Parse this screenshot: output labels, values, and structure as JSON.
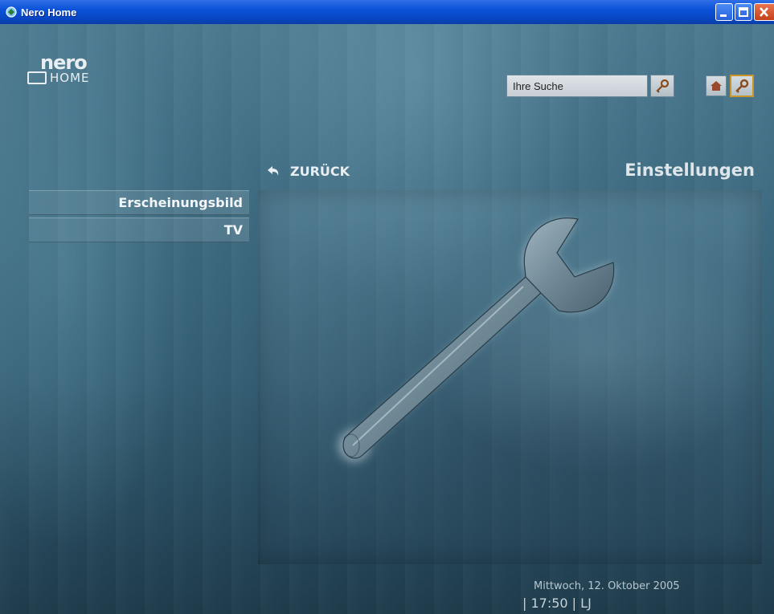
{
  "window": {
    "title": "Nero Home",
    "icons": {
      "app": "nero-app-icon",
      "minimize": "minimize-icon",
      "maximize": "maximize-icon",
      "close": "close-icon"
    }
  },
  "logo": {
    "brand": "nero",
    "product": "HOME"
  },
  "header": {
    "search": {
      "value": "Ihre Suche",
      "button_icon": "search-key-icon"
    },
    "home_icon": "home-icon",
    "settings_icon": "wrench-icon",
    "settings_active_color": "#c9962a"
  },
  "nav": {
    "back_label": "ZURÜCK",
    "back_icon": "back-arrow-icon"
  },
  "page": {
    "title": "Einstellungen",
    "illustration": "wrench-illustration"
  },
  "menu": {
    "items": [
      {
        "label": "Erscheinungsbild"
      },
      {
        "label": "TV"
      }
    ]
  },
  "footer": {
    "date": "Mittwoch, 12. Oktober 2005",
    "time": "| 17:50 | LJ"
  },
  "colors": {
    "titlebar": "#0a52d8",
    "background": "#3d6a80",
    "text": "#f2f6f8"
  }
}
